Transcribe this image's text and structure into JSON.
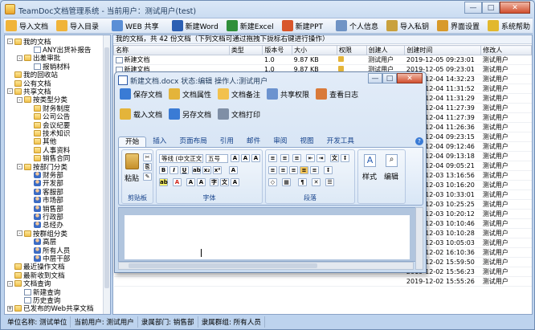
{
  "app": {
    "title": "TeamDoc文档管理系统 - 当前用户：测试用户(test)"
  },
  "toolbar": [
    {
      "label": "导入文档",
      "icon": "import-folder-icon",
      "color": "#f0b43a"
    },
    {
      "label": "导入目录",
      "icon": "import-dir-icon",
      "color": "#f0b43a"
    },
    {
      "label": "WEB 共享",
      "icon": "web-share-icon",
      "color": "#5b8fd6"
    },
    {
      "label": "新建Word",
      "icon": "word-icon",
      "color": "#2b5fb3"
    },
    {
      "label": "新建Excel",
      "icon": "excel-icon",
      "color": "#2f8f3a"
    },
    {
      "label": "新建PPT",
      "icon": "ppt-icon",
      "color": "#d8562b"
    },
    {
      "label": "个人信息",
      "icon": "user-info-icon",
      "color": "#6f93c5"
    },
    {
      "label": "导入私钥",
      "icon": "key-icon",
      "color": "#c9a13d"
    },
    {
      "label": "界面设置",
      "icon": "settings-icon",
      "color": "#d89a2b"
    },
    {
      "label": "系统帮助",
      "icon": "help-icon",
      "color": "#e2b82e"
    }
  ],
  "tree": [
    {
      "label": "我的文档",
      "d": 0,
      "icon": "folder",
      "exp": "-"
    },
    {
      "label": "ANY出货补报告",
      "d": 2,
      "icon": "doc"
    },
    {
      "label": "出差审批",
      "d": 1,
      "icon": "folder",
      "exp": "-"
    },
    {
      "label": "报销材料",
      "d": 2,
      "icon": "doc"
    },
    {
      "label": "我的回收站",
      "d": 0,
      "icon": "folder"
    },
    {
      "label": "公有文档",
      "d": 0,
      "icon": "folder"
    },
    {
      "label": "共享文档",
      "d": 0,
      "icon": "folder",
      "exp": "-"
    },
    {
      "label": "按类型分类",
      "d": 1,
      "icon": "folder",
      "exp": "-"
    },
    {
      "label": "财务制度",
      "d": 2,
      "icon": "folder"
    },
    {
      "label": "公司公告",
      "d": 2,
      "icon": "folder"
    },
    {
      "label": "会议纪要",
      "d": 2,
      "icon": "folder"
    },
    {
      "label": "技术知识",
      "d": 2,
      "icon": "folder"
    },
    {
      "label": "其他",
      "d": 2,
      "icon": "folder"
    },
    {
      "label": "人事资料",
      "d": 2,
      "icon": "folder"
    },
    {
      "label": "销售合同",
      "d": 2,
      "icon": "folder"
    },
    {
      "label": "按部门分类",
      "d": 1,
      "icon": "folder",
      "exp": "-"
    },
    {
      "label": "财务部",
      "d": 2,
      "icon": "person"
    },
    {
      "label": "开发部",
      "d": 2,
      "icon": "person"
    },
    {
      "label": "客服部",
      "d": 2,
      "icon": "person"
    },
    {
      "label": "市场部",
      "d": 2,
      "icon": "person"
    },
    {
      "label": "销售部",
      "d": 2,
      "icon": "person"
    },
    {
      "label": "行政部",
      "d": 2,
      "icon": "person"
    },
    {
      "label": "总经办",
      "d": 2,
      "icon": "person"
    },
    {
      "label": "按群组分类",
      "d": 1,
      "icon": "folder",
      "exp": "-"
    },
    {
      "label": "高层",
      "d": 2,
      "icon": "person"
    },
    {
      "label": "所有人员",
      "d": 2,
      "icon": "person"
    },
    {
      "label": "中层干部",
      "d": 2,
      "icon": "person"
    },
    {
      "label": "最近操作文档",
      "d": 0,
      "icon": "folder"
    },
    {
      "label": "最新收到文档",
      "d": 0,
      "icon": "folder"
    },
    {
      "label": "文档查询",
      "d": 0,
      "icon": "folder",
      "exp": "-"
    },
    {
      "label": "新建查询",
      "d": 1,
      "icon": "doc"
    },
    {
      "label": "历史查询",
      "d": 1,
      "icon": "doc"
    },
    {
      "label": "已发布的Web共享文档",
      "d": 0,
      "icon": "folder",
      "exp": "+"
    }
  ],
  "main": {
    "header": "我的文档，共 42 份文档（下列文档可通过拖拽下拢标右键进行操作）",
    "columns": [
      "名称",
      "类型",
      "版本号",
      "大小",
      "权限",
      "创建人",
      "创建时间",
      "修改人"
    ],
    "rows": [
      [
        "新建文档",
        "",
        "1.0",
        "9.87 KB",
        "",
        "测试用户",
        "2019-12-05 09:23:01",
        "测试用户"
      ],
      [
        "新建文档",
        "",
        "1.0",
        "9.87 KB",
        "",
        "测试用户",
        "2019-12-05 09:23:01",
        "测试用户"
      ],
      [
        "",
        "",
        "",
        "",
        "",
        "",
        "2019-12-04 14:32:23",
        "测试用户"
      ],
      [
        "",
        "",
        "",
        "",
        "",
        "",
        "2019-12-04 11:31:52",
        "测试用户"
      ],
      [
        "",
        "",
        "",
        "",
        "",
        "",
        "2019-12-04 11:31:29",
        "测试用户"
      ],
      [
        "",
        "",
        "",
        "",
        "",
        "",
        "2019-12-04 11:27:39",
        "测试用户"
      ],
      [
        "",
        "",
        "",
        "",
        "",
        "",
        "2019-12-04 11:27:39",
        "测试用户"
      ],
      [
        "",
        "",
        "",
        "",
        "",
        "",
        "2019-12-04 11:26:36",
        "测试用户"
      ],
      [
        "",
        "",
        "",
        "",
        "",
        "",
        "2019-12-04 09:23:15",
        "测试用户"
      ],
      [
        "",
        "",
        "",
        "",
        "",
        "",
        "2019-12-04 09:12:46",
        "测试用户"
      ],
      [
        "",
        "",
        "",
        "",
        "",
        "",
        "2019-12-04 09:13:18",
        "测试用户"
      ],
      [
        "",
        "",
        "",
        "",
        "",
        "",
        "2019-12-04 09:05:21",
        "测试用户"
      ],
      [
        "",
        "",
        "",
        "",
        "",
        "",
        "2019-12-03 13:16:56",
        "测试用户"
      ],
      [
        "",
        "",
        "",
        "",
        "",
        "",
        "2019-12-03 10:16:20",
        "测试用户"
      ],
      [
        "",
        "",
        "",
        "",
        "",
        "",
        "2019-12-03 10:33:01",
        "测试用户"
      ],
      [
        "",
        "",
        "",
        "",
        "",
        "",
        "2019-12-03 10:25:25",
        "测试用户"
      ],
      [
        "",
        "",
        "",
        "",
        "",
        "",
        "2019-12-03 10:20:12",
        "测试用户"
      ],
      [
        "",
        "",
        "",
        "",
        "",
        "",
        "2019-12-03 10:10:46",
        "测试用户"
      ],
      [
        "",
        "",
        "",
        "",
        "",
        "",
        "2019-12-03 10:10:28",
        "测试用户"
      ],
      [
        "",
        "",
        "",
        "",
        "",
        "",
        "2019-12-03 10:05:03",
        "测试用户"
      ],
      [
        "",
        "",
        "",
        "",
        "",
        "",
        "2019-12-02 16:10:36",
        "测试用户"
      ],
      [
        "",
        "",
        "",
        "",
        "",
        "",
        "2019-12-02 15:59:50",
        "测试用户"
      ],
      [
        "",
        "",
        "",
        "",
        "",
        "",
        "2019-12-02 15:56:23",
        "测试用户"
      ],
      [
        "",
        "",
        "",
        "",
        "",
        "",
        "2019-12-02 15:55:26",
        "测试用户"
      ]
    ]
  },
  "status": [
    "单位名称: 测试单位",
    "当前用户: 测试用户",
    "隶属部门: 销售部",
    "隶属群组: 所有人员"
  ],
  "dialog": {
    "title": "新建文档.docx 状态:编辑 操作人:测试用户",
    "row1": [
      "保存文档",
      "文档属性",
      "文档备注",
      "共享权限",
      "查看日志"
    ],
    "row2": [
      "载入文档",
      "另存文档",
      "文档打印"
    ],
    "tabs": [
      "开始",
      "插入",
      "页面布局",
      "引用",
      "邮件",
      "审阅",
      "视图",
      "开发工具"
    ],
    "groups": {
      "clipboard": "剪贴板",
      "font": "字体",
      "paragraph": "段落",
      "styles": "样式",
      "editing": "编辑",
      "paste": "粘贴"
    },
    "font_name": "等线 (中文正文",
    "font_size": "五号"
  }
}
